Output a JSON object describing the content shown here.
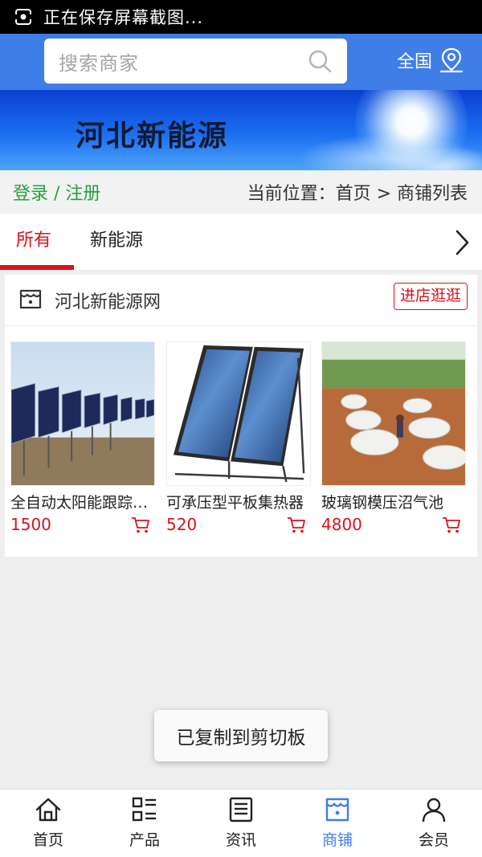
{
  "status_bar": {
    "text": "正在保存屏幕截图..."
  },
  "header": {
    "search_placeholder": "搜索商家",
    "region": "全国"
  },
  "banner": {
    "title": "河北新能源"
  },
  "breadcrumb": {
    "login": "登录 / 注册",
    "location": "当前位置：首页 > 商铺列表"
  },
  "tabs": [
    {
      "label": "所有",
      "active": true
    },
    {
      "label": "新能源",
      "active": false
    }
  ],
  "shop": {
    "name": "河北新能源网",
    "enter_label": "进店逛逛",
    "products": [
      {
        "title": "全自动太阳能跟踪系统",
        "price": "1500"
      },
      {
        "title": "可承压型平板集热器",
        "price": "520"
      },
      {
        "title": "玻璃钢模压沼气池",
        "price": "4800"
      }
    ]
  },
  "toast": "已复制到剪切板",
  "bottom_nav": [
    {
      "label": "首页",
      "icon": "home-icon"
    },
    {
      "label": "产品",
      "icon": "grid-list-icon"
    },
    {
      "label": "资讯",
      "icon": "news-icon"
    },
    {
      "label": "商铺",
      "icon": "shop-icon",
      "active": true
    },
    {
      "label": "会员",
      "icon": "user-icon"
    }
  ],
  "colors": {
    "primary": "#3f7ee6",
    "accent_red": "#d7141c",
    "login_green": "#27a042"
  }
}
